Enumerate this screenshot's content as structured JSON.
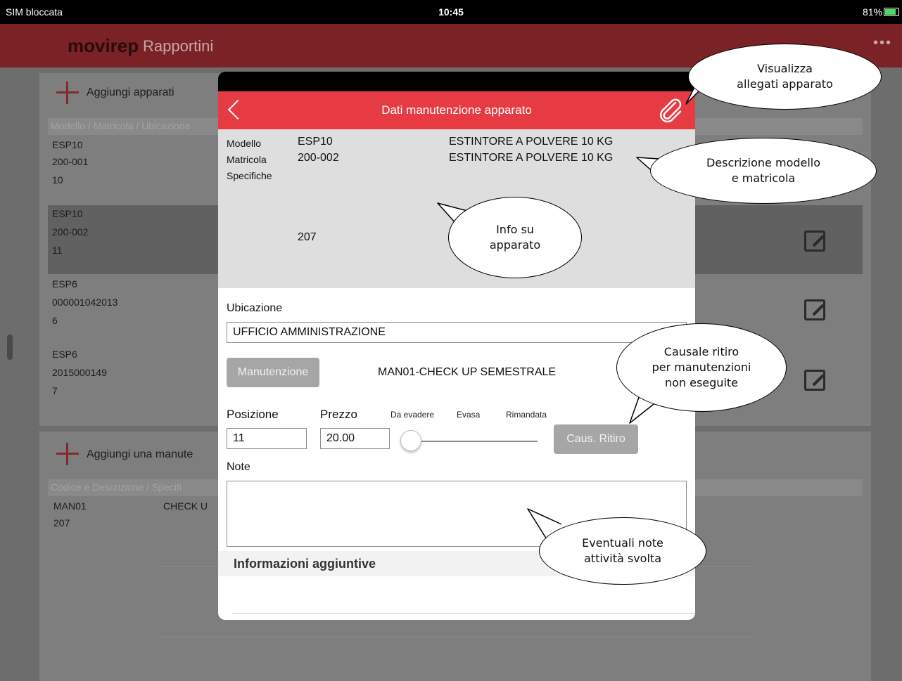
{
  "status_bar": {
    "carrier": "SIM bloccata",
    "time": "10:45",
    "battery": "81%"
  },
  "app_header": {
    "logo": "movirep",
    "subtitle": "Rapportini",
    "more": "•••"
  },
  "background": {
    "apparati": {
      "add_label": "Aggiungi apparati",
      "header": "Modello / Matricola / Ubicazione",
      "rows": [
        {
          "line1": "ESP10",
          "line2": "200-001",
          "line3": "10"
        },
        {
          "line1": "ESP10",
          "line2": "200-002",
          "line3": "11"
        },
        {
          "line1": "ESP6",
          "line2": "000001042013",
          "line3": "6"
        },
        {
          "line1": "ESP6",
          "line2": "2015000149",
          "line3": "7"
        }
      ]
    },
    "manutenzioni": {
      "add_label": "Aggiungi una manute",
      "header": "Codice e Descrizione / Specifi",
      "rows": [
        {
          "code": "MAN01",
          "desc": "CHECK U",
          "extra": "207"
        }
      ]
    }
  },
  "modal": {
    "title": "Dati manutenzione apparato",
    "info": {
      "modello_label": "Modello",
      "modello_value": "ESP10",
      "modello_desc": "ESTINTORE A POLVERE 10 KG",
      "matricola_label": "Matricola",
      "matricola_value": "200-002",
      "matricola_desc": "ESTINTORE A POLVERE 10 KG",
      "specifiche_label": "Specifiche",
      "specifiche_value": "207"
    },
    "ubicazione_label": "Ubicazione",
    "ubicazione_value": "UFFICIO AMMINISTRAZIONE",
    "manutenzione_button": "Manutenzione",
    "manutenzione_value": "MAN01-CHECK UP SEMESTRALE",
    "posizione_label": "Posizione",
    "posizione_value": "11",
    "prezzo_label": "Prezzo",
    "prezzo_value": "20.00",
    "slider_states": [
      "Da evadere",
      "Evasa",
      "Rimandata"
    ],
    "slider_selected": "Da evadere",
    "caus_ritiro_button": "Caus. Ritiro",
    "note_label": "Note",
    "note_value": "",
    "informazioni_label": "Informazioni aggiuntive"
  },
  "callouts": {
    "visualizza": [
      "Visualizza",
      "allegati apparato"
    ],
    "descrizione": [
      "Descrizione modello",
      "e matricola"
    ],
    "info": [
      "Info su",
      "apparato"
    ],
    "causale": [
      "Causale ritiro",
      "per manutenzioni",
      "non eseguite"
    ],
    "note": [
      "Eventuali note",
      "attività svolta"
    ]
  },
  "colors": {
    "accent_red": "#e73b44",
    "header_dim": "#7a2226",
    "button_grey": "#a6a6a6"
  }
}
